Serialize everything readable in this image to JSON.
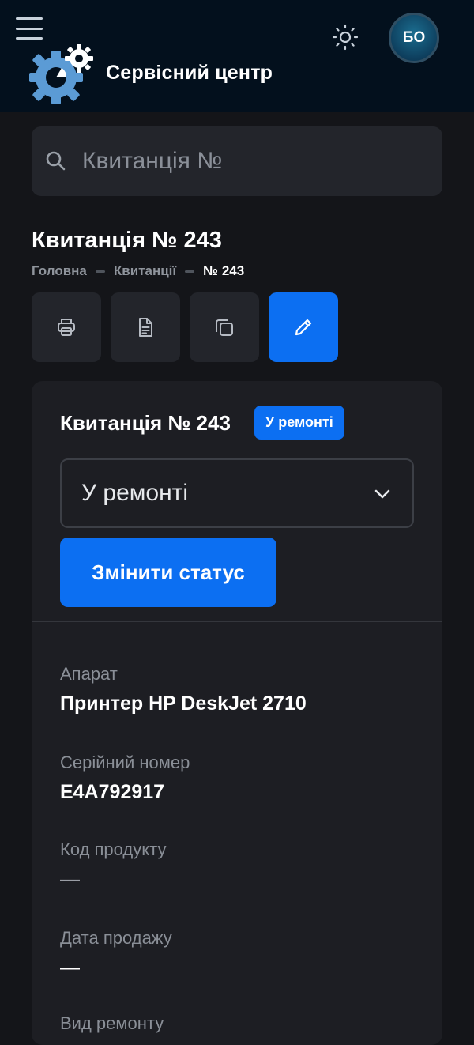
{
  "header": {
    "brand": "Сервісний центр",
    "avatar_initials": "БО",
    "icons": [
      "menu-icon",
      "gear-logo-icon",
      "sun-icon"
    ],
    "colors": {
      "background": "#03101d",
      "logo": "#5b9bd5"
    }
  },
  "search": {
    "placeholder": "Квитанція №",
    "icon": "search-icon"
  },
  "page": {
    "title": "Квитанція № 243",
    "breadcrumb": [
      "Головна",
      "Квитанції",
      "№ 243"
    ]
  },
  "actions": [
    {
      "name": "print-button",
      "icon": "printer-icon"
    },
    {
      "name": "document-button",
      "icon": "document-icon"
    },
    {
      "name": "copy-button",
      "icon": "copy-icon"
    },
    {
      "name": "edit-button",
      "icon": "pencil-icon",
      "primary": true
    }
  ],
  "card": {
    "title": "Квитанція № 243",
    "status_badge": "У ремонті",
    "status_select": "У ремонті",
    "change_status_label": "Змінити статус",
    "fields": [
      {
        "label": "Апарат",
        "value": "Принтер HP DeskJet 2710"
      },
      {
        "label": "Серійний номер",
        "value": "E4A792917"
      },
      {
        "label": "Код продукту",
        "value": "—"
      },
      {
        "label": "Дата продажу",
        "value": "—"
      },
      {
        "label": "Вид ремонту",
        "value": ""
      }
    ]
  },
  "colors": {
    "accent": "#0c6ff2",
    "page_bg": "#141519",
    "card_bg": "#1d1e23"
  }
}
